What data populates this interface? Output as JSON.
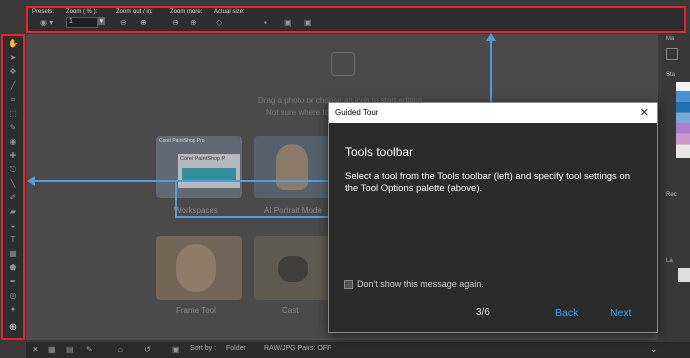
{
  "tool_options": {
    "labels": [
      "Presets:",
      "Zoom ( % ):",
      "Zoom out / in:",
      "Zoom more:",
      "Actual size:"
    ],
    "zoom_value": "1"
  },
  "workspace": {
    "hint_line1": "Drag a photo or choose an icon to start editing.",
    "hint_line2": "Not sure where to start? Try a tour.",
    "thumbs": [
      {
        "label": "Workspaces"
      },
      {
        "label": "AI Portrait Mode"
      },
      {
        "label": "Frame Tool"
      },
      {
        "label": "Cast"
      }
    ],
    "mini_app_title": "Corel PaintShop Pro",
    "mini_app_subtitle": "Corel PaintShop P"
  },
  "right_panel": {
    "labels": [
      "Ma",
      "Sta",
      "Rec",
      "La"
    ]
  },
  "status_bar": {
    "sort_label": "Sort by :",
    "sort_value": "Folder",
    "raw_label": "RAW/JPG Pairs: OFF"
  },
  "dialog": {
    "title": "Guided Tour",
    "close_glyph": "✕",
    "heading": "Tools toolbar",
    "body": "Select a tool from the Tools toolbar (left) and specify tool settings on the Tool Options palette (above).",
    "checkbox_label": "Don't show this message again.",
    "page_indicator": "3/6",
    "back_label": "Back",
    "next_label": "Next"
  },
  "colors": {
    "highlight": "#e8232f",
    "arrow": "#5b9bd5",
    "accent_link": "#3d9ef0"
  }
}
